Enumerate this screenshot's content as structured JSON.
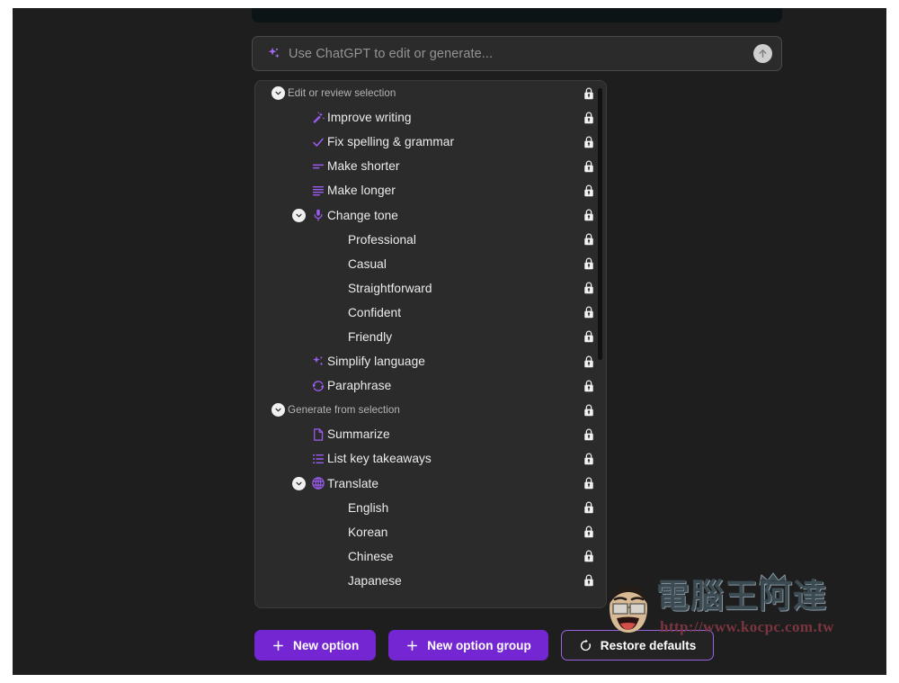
{
  "theme": {
    "background": "#1e1e1e",
    "card_background": "#2b2b2b",
    "accent_purple": "#7526d3",
    "icon_purple": "#9b5cf0",
    "text_primary": "#ececec",
    "text_muted": "#b4b4b4",
    "border": "#3c3c3c"
  },
  "prompt": {
    "placeholder": "Use ChatGPT to edit or generate...",
    "spark_icon": "sparkles-icon",
    "send_icon": "arrow-up-circle-icon"
  },
  "options": {
    "rows": [
      {
        "label": "Edit or review selection",
        "type": "group",
        "indent": 0,
        "toggle": true,
        "icon": null,
        "lock": true
      },
      {
        "label": "Improve writing",
        "type": "option",
        "indent": 1,
        "toggle": false,
        "icon": "magic-wand-icon",
        "lock": true
      },
      {
        "label": "Fix spelling & grammar",
        "type": "option",
        "indent": 1,
        "toggle": false,
        "icon": "check-icon",
        "lock": true
      },
      {
        "label": "Make shorter",
        "type": "option",
        "indent": 1,
        "toggle": false,
        "icon": "shorten-icon",
        "lock": true
      },
      {
        "label": "Make longer",
        "type": "option",
        "indent": 1,
        "toggle": false,
        "icon": "lengthen-icon",
        "lock": true
      },
      {
        "label": "Change tone",
        "type": "option",
        "indent": 2,
        "toggle": true,
        "icon": "microphone-icon",
        "lock": true
      },
      {
        "label": "Professional",
        "type": "option",
        "indent": 3,
        "toggle": false,
        "icon": null,
        "lock": true
      },
      {
        "label": "Casual",
        "type": "option",
        "indent": 3,
        "toggle": false,
        "icon": null,
        "lock": true
      },
      {
        "label": "Straightforward",
        "type": "option",
        "indent": 3,
        "toggle": false,
        "icon": null,
        "lock": true
      },
      {
        "label": "Confident",
        "type": "option",
        "indent": 3,
        "toggle": false,
        "icon": null,
        "lock": true
      },
      {
        "label": "Friendly",
        "type": "option",
        "indent": 3,
        "toggle": false,
        "icon": null,
        "lock": true
      },
      {
        "label": "Simplify language",
        "type": "option",
        "indent": 1,
        "toggle": false,
        "icon": "sparkles-icon",
        "lock": true
      },
      {
        "label": "Paraphrase",
        "type": "option",
        "indent": 1,
        "toggle": false,
        "icon": "refresh-icon",
        "lock": true
      },
      {
        "label": "Generate from selection",
        "type": "group",
        "indent": 0,
        "toggle": true,
        "icon": null,
        "lock": true
      },
      {
        "label": "Summarize",
        "type": "option",
        "indent": 1,
        "toggle": false,
        "icon": "document-icon",
        "lock": true
      },
      {
        "label": "List key takeaways",
        "type": "option",
        "indent": 1,
        "toggle": false,
        "icon": "list-icon",
        "lock": true
      },
      {
        "label": "Translate",
        "type": "option",
        "indent": 2,
        "toggle": true,
        "icon": "globe-icon",
        "lock": true
      },
      {
        "label": "English",
        "type": "option",
        "indent": 3,
        "toggle": false,
        "icon": null,
        "lock": true
      },
      {
        "label": "Korean",
        "type": "option",
        "indent": 3,
        "toggle": false,
        "icon": null,
        "lock": true
      },
      {
        "label": "Chinese",
        "type": "option",
        "indent": 3,
        "toggle": false,
        "icon": null,
        "lock": true
      },
      {
        "label": "Japanese",
        "type": "option",
        "indent": 3,
        "toggle": false,
        "icon": null,
        "lock": true
      }
    ]
  },
  "actions": {
    "new_option": {
      "label": "New option",
      "icon": "plus-icon"
    },
    "new_option_group": {
      "label": "New option group",
      "icon": "plus-icon"
    },
    "restore_defaults": {
      "label": "Restore defaults",
      "icon": "restore-icon"
    }
  },
  "watermark": {
    "title": "電腦王阿達",
    "url": "http://www.kocpc.com.tw"
  }
}
